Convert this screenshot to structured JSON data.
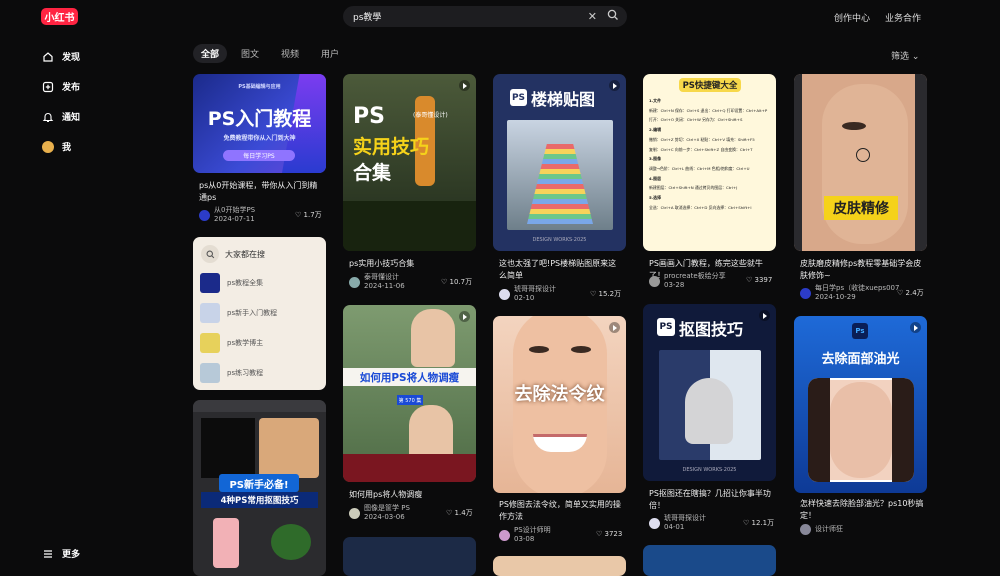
{
  "app": {
    "logo": "小红书"
  },
  "search": {
    "value": "ps教學",
    "clear_icon": "close-icon",
    "search_icon": "search-icon"
  },
  "header": {
    "creator": "创作中心",
    "business": "业务合作"
  },
  "sidebar": {
    "items": [
      {
        "label": "发现",
        "icon": "home-icon"
      },
      {
        "label": "发布",
        "icon": "plus-square-icon"
      },
      {
        "label": "通知",
        "icon": "bell-icon"
      },
      {
        "label": "我",
        "icon": "avatar"
      }
    ],
    "more": "更多"
  },
  "tabs": [
    "全部",
    "图文",
    "视频",
    "用户"
  ],
  "filter": "筛选",
  "related": {
    "title": "大家都在搜",
    "items": [
      "ps教程全集",
      "ps新手入门教程",
      "ps教学博主",
      "ps练习教程"
    ]
  },
  "cards": [
    {
      "title": "ps从0开始课程，带你从入门到精通ps",
      "author": "从0开始学PS",
      "date": "2024-07-11",
      "likes": "1.7万",
      "cover": {
        "tag": "PS基础编辑与应用",
        "main": "PS入门教程",
        "sub": "免费教程带你从入门到大神",
        "badge": "每日学习PS"
      }
    },
    {
      "title": "",
      "author": "",
      "date": "",
      "likes": "",
      "cover": {
        "main": "PS新手必备!",
        "sub": "4种PS常用抠图技巧"
      }
    },
    {
      "title": "ps实用小技巧合集",
      "author": "泰哥懂设计",
      "date": "2024-11-06",
      "likes": "10.7万",
      "cover": {
        "tag": "(泰哥懂设计)",
        "main": "PS",
        "sub": "实用技巧",
        "third": "合集"
      }
    },
    {
      "title": "如何用ps将人物调瘦",
      "author": "图像是筐学 PS",
      "date": "2024-03-06",
      "likes": "1.4万",
      "cover": {
        "main": "如何用PS将人物调瘦",
        "badge": "第 570 集"
      }
    },
    {
      "title": "这也太强了吧!PS楼梯贴图原来这么简单",
      "author": "琥哥哥探设计",
      "date": "02-10",
      "likes": "15.2万",
      "cover": {
        "main": "楼梯贴图",
        "ps": "PS",
        "foot": "DESIGN WORKS·2025"
      }
    },
    {
      "title": "PS修图去法令纹，简单又实用的操作方法",
      "author": "PS设计师明",
      "date": "03-08",
      "likes": "3723",
      "cover": {
        "main": "去除法令纹"
      }
    },
    {
      "title": "PS画画入门教程，练完这些就牛了！",
      "author": "procreate板绘分享",
      "date": "03-28",
      "likes": "3397",
      "cover": {
        "main": "PS快捷键大全"
      }
    },
    {
      "title": "PS抠图还在瞎搞？几招让你事半功倍！",
      "author": "琥哥哥探设计",
      "date": "04-01",
      "likes": "12.1万",
      "cover": {
        "main": "抠图技巧",
        "ps": "PS",
        "foot": "DESIGN WORKS·2025"
      }
    },
    {
      "title": "皮肤磨皮精修ps教程零基础学会皮肤修饰~",
      "author": "每日学ps（收徒xueps007",
      "date": "2024-10-29",
      "likes": "2.4万",
      "cover": {
        "main": "皮肤精修"
      }
    },
    {
      "title": "怎样快速去除脸部油光？ps10秒搞定！",
      "author": "设计师狂",
      "date": "",
      "likes": "",
      "cover": {
        "main": "去除面部油光",
        "ps": "Ps"
      }
    }
  ],
  "cheat_sheet": [
    "1.文件",
    "新建：Ctrl+N  保存：Ctrl+S  退出：Ctrl+Q  打印设置：Ctrl+Alt+P",
    "打开：Ctrl+O  关闭：Ctrl+W  另存为：Ctrl+Shift+S",
    "2.编辑",
    "撤销：Ctrl+Z  剪切：Ctrl+X  粘贴：Ctrl+V  填充：Shift+F5",
    "复制：Ctrl+C  向前一步：Ctrl+Shift+Z  自由变换：Ctrl+T",
    "3.图像",
    "调整→色阶：Ctrl+L  曲线：Ctrl+M  色相/饱和度：Ctrl+U",
    "4.图层",
    "新建图层：Ctrl+Shift+N  通过拷贝的图层：Ctrl+J",
    "5.选择",
    "全选：Ctrl+A  取消选择：Ctrl+D  反向选择：Ctrl+Shift+I"
  ],
  "colors": {
    "bg": "#0b0b0c",
    "brand": "#ff2442",
    "card_panel": "#f3ede4"
  }
}
